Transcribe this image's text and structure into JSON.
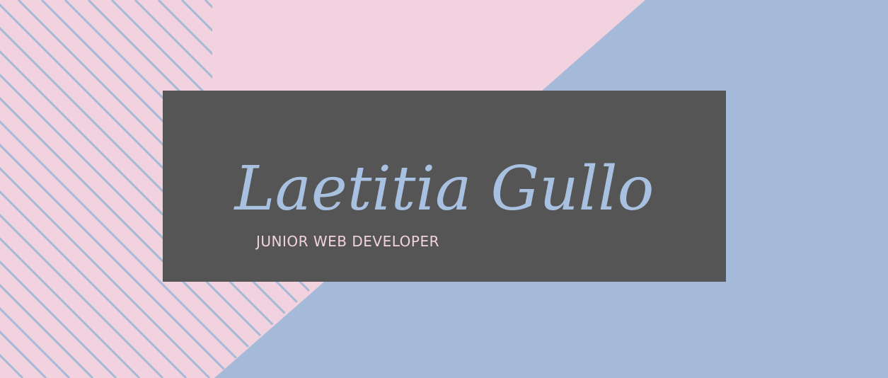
{
  "banner": {
    "name": "Laetitia Gullo",
    "title": "JUNIOR WEB DEVELOPER"
  },
  "colors": {
    "pink": "#f1d2de",
    "blue": "#a5bad9",
    "card": "#555555",
    "name_text": "#a9c1e0",
    "title_text": "#f1d2de"
  }
}
